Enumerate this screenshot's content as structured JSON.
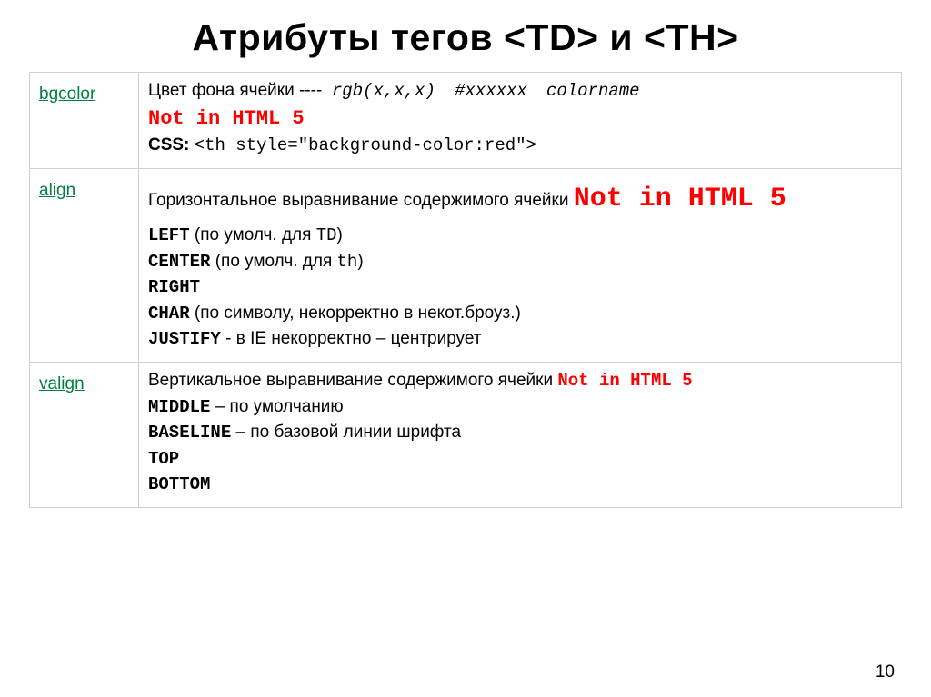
{
  "title": "Атрибуты тегов <TD> и <TH>",
  "page_number": "10",
  "rows": {
    "bgcolor": {
      "name": "bgcolor",
      "desc": "Цвет фона ячейки ----",
      "rgb": "rgb(x,x,x)",
      "hex": "#хххххх",
      "colorname": "colorname",
      "not5": "Not in HTML 5",
      "css_label": "CSS:",
      "css_code": "<th style=\"background-color:red\">"
    },
    "align": {
      "name": "align",
      "desc": "Горизонтальное выравнивание содержимого ячейки",
      "not5": "Not in HTML 5",
      "values": {
        "left_code": "LEFT",
        "left_text": " (по умолч. для ",
        "left_tag": "TD",
        "left_close": ")",
        "center_code": "CENTER",
        "center_text": " (по умолч. для ",
        "center_tag": "th",
        "center_close": ")",
        "right_code": "RIGHT",
        "char_code": "CHAR",
        "char_text": " (по символу, некорректно в некот.броуз.)",
        "justify_code": "JUSTIFY",
        "justify_text": " - в IE некорректно – центрирует"
      }
    },
    "valign": {
      "name": "valign",
      "desc": "Вертикальное выравнивание содержимого ячейки ",
      "not5": "Not in HTML 5",
      "values": {
        "middle_code": "MIDDLE",
        "middle_text": " – по умолчанию",
        "baseline_code": "BASELINE",
        "baseline_text": " – по базовой линии шрифта",
        "top_code": "TOP",
        "bottom_code": "BOTTOM"
      }
    }
  }
}
